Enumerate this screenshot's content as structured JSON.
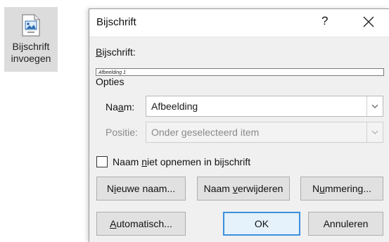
{
  "ribbon": {
    "label_line1": "Bijschrift",
    "label_line2": "invoegen",
    "icon": "insert-caption-icon"
  },
  "dialog": {
    "title": "Bijschrift",
    "help_glyph": "?",
    "caption_label": "Bijschrift:",
    "caption_value": "Afbeelding 1",
    "options_heading": "Opties",
    "name_label": "Naam:",
    "name_value": "Afbeelding",
    "position_label": "Positie:",
    "position_value": "Onder geselecteerd item",
    "exclude_label_checkbox": "Naam niet opnemen in bijschrift",
    "exclude_checked": false,
    "buttons": {
      "new_label": "Nieuwe naam...",
      "delete_label": "Naam verwijderen",
      "numbering": "Nummering...",
      "autocaption": "Automatisch...",
      "ok": "OK",
      "cancel": "Annuleren"
    }
  },
  "colors": {
    "ribbon_bg": "#dcdcdc",
    "dialog_bg": "#f0f0f0",
    "primary_border": "#3c8fdc"
  }
}
